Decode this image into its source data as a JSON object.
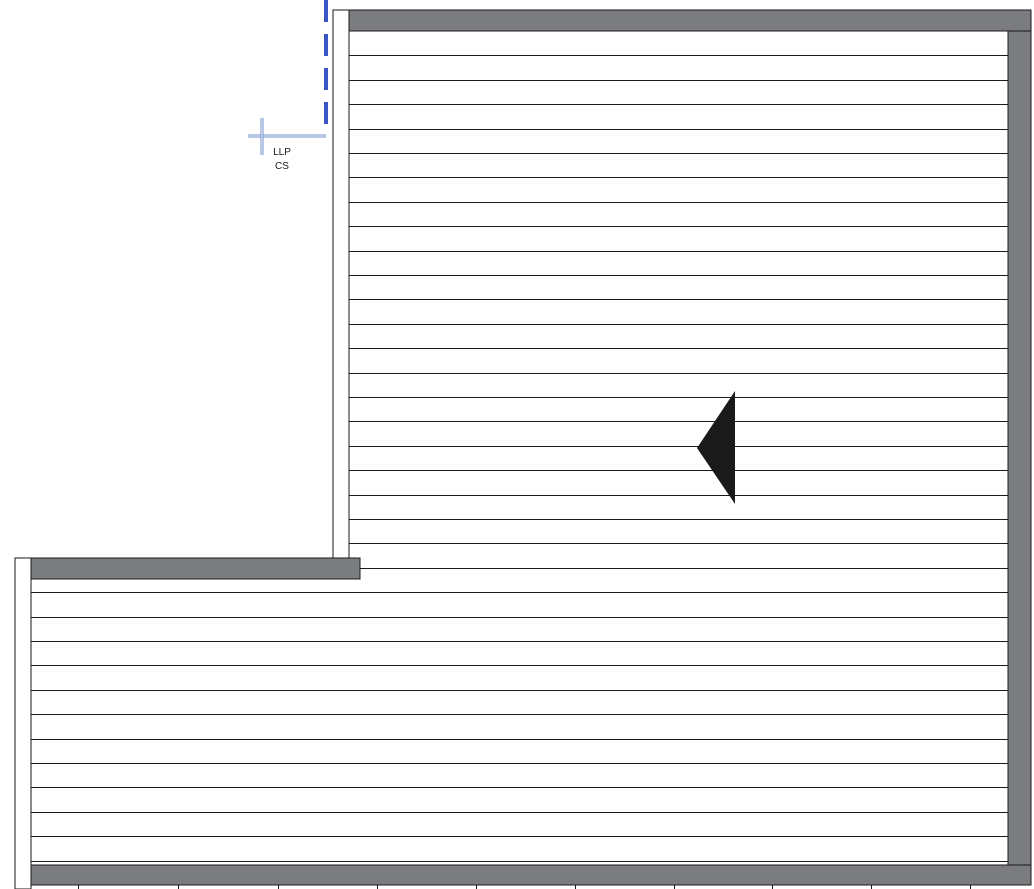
{
  "colors": {
    "background": "#ffffff",
    "band_fill": "#7b7c80",
    "line": "#1a1a1a",
    "marker": "#1a1a1a",
    "blue_dashed": "#3a56c4",
    "crosshair": "#7090c8"
  },
  "icons": {
    "direction_marker": "left-pointing-triangle-icon",
    "crosshair": "crosshair-icon"
  },
  "marker_label": {
    "line1": "LLP",
    "line2": "CS"
  }
}
